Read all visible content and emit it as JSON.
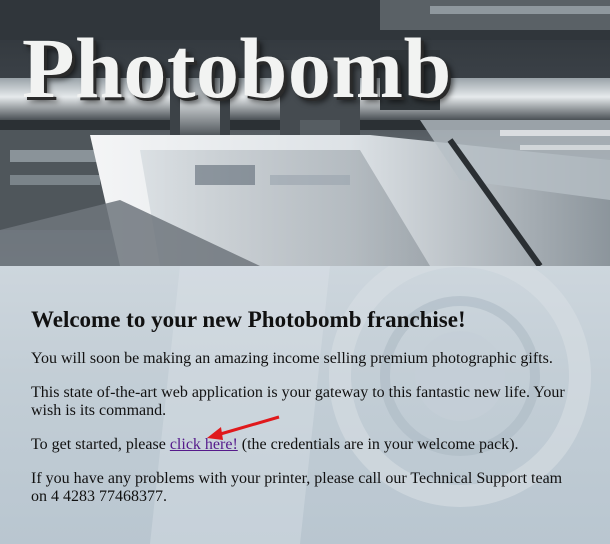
{
  "header": {
    "title": "Photobomb"
  },
  "main": {
    "heading": "Welcome to your new Photobomb franchise!",
    "para1": "You will soon be making an amazing income selling premium photographic gifts.",
    "para2": "This state of-the-art web application is your gateway to this fantastic new life. Your wish is its command.",
    "para3_before": "To get started, please ",
    "link_label": "click here!",
    "para3_after": " (the credentials are in your welcome pack).",
    "para4": "If you have any problems with your printer, please call our Technical Support team on 4 4283 77468377."
  },
  "colors": {
    "link": "#551a8b",
    "annotation_arrow": "#e0191c"
  },
  "icons": {
    "annotation": "red-arrow-icon"
  }
}
